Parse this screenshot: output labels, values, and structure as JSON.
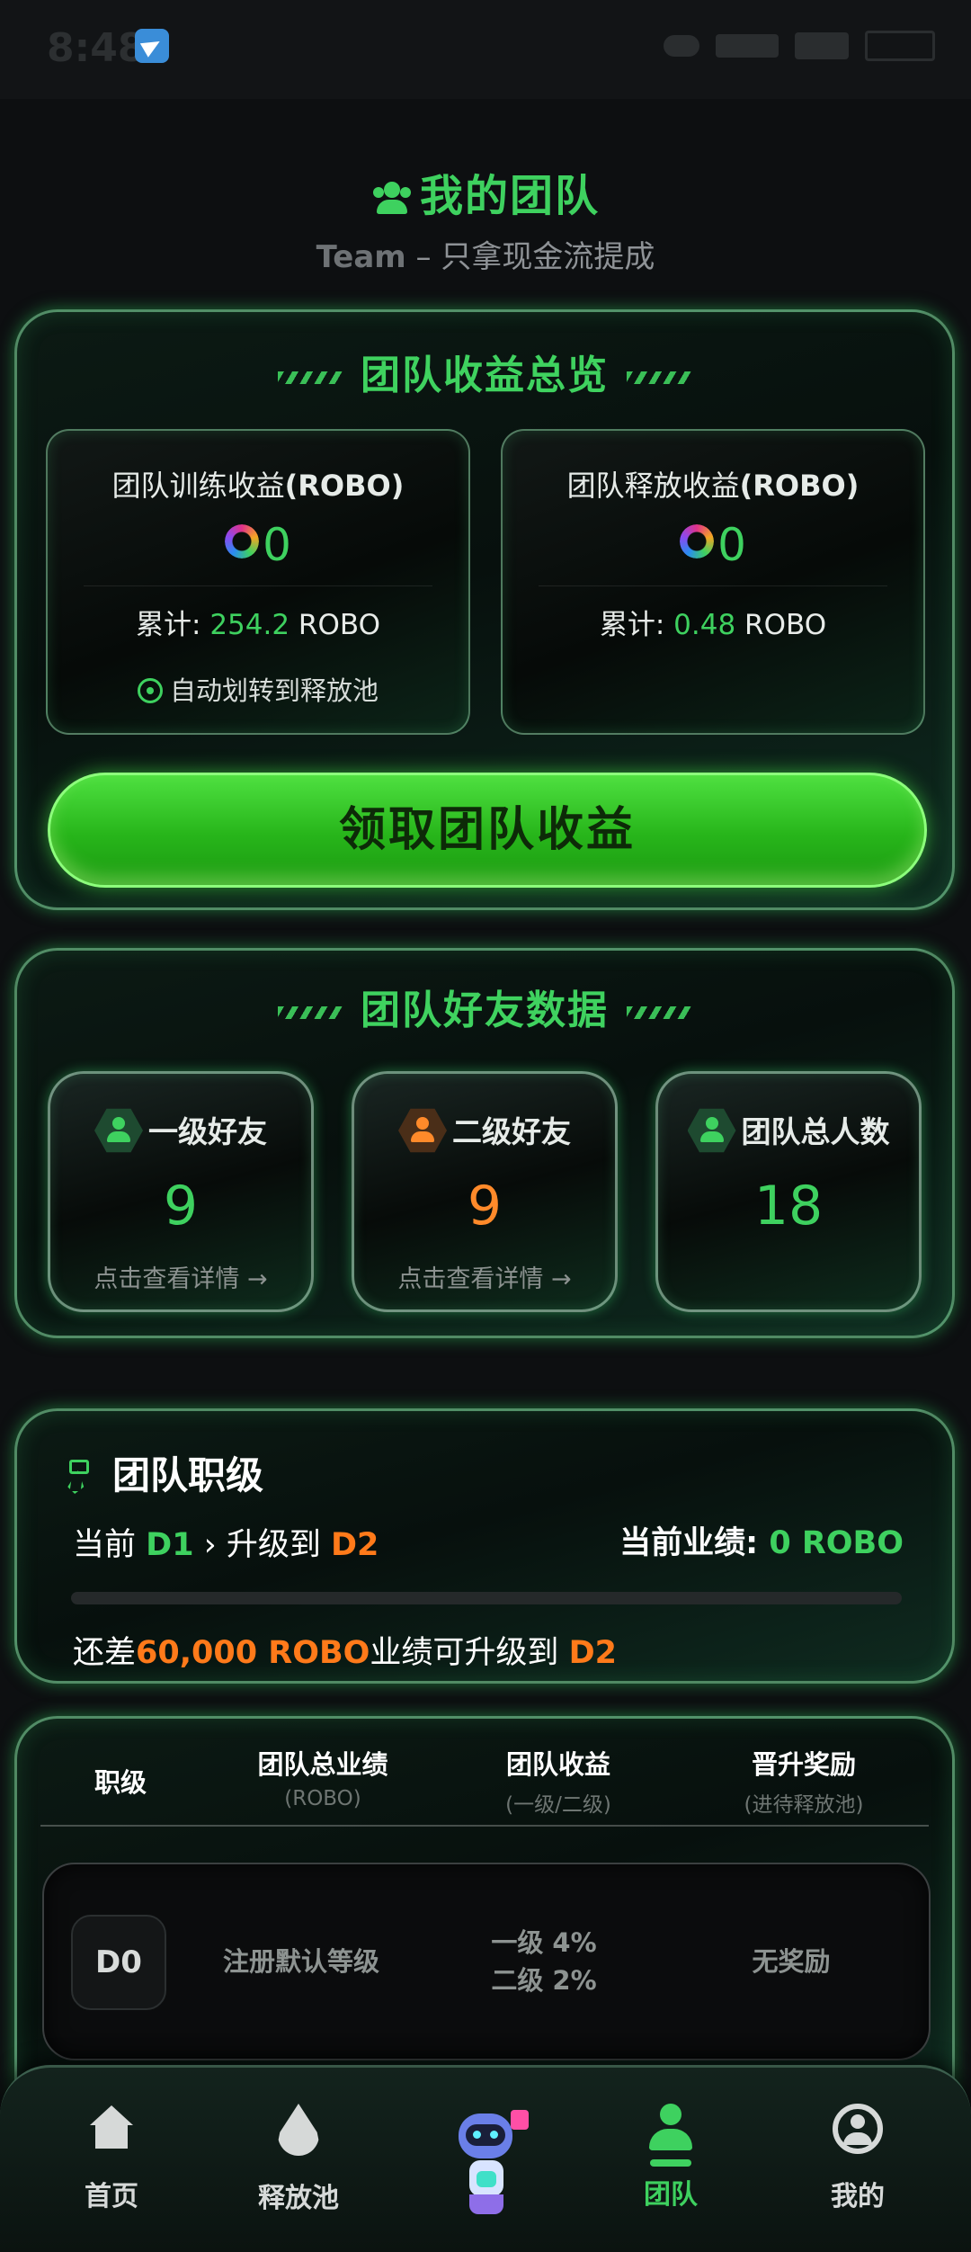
{
  "status_bar": {
    "time": "8:48"
  },
  "header": {
    "title": "我的团队",
    "subtitle_brand": "Team",
    "subtitle_text": "– 只拿现金流提成"
  },
  "overview": {
    "heading": "团队收益总览",
    "training": {
      "title": "团队训练收益",
      "unit": "(ROBO)",
      "value": "0",
      "total_label": "累计: ",
      "total_value": "254.2",
      "total_unit": " ROBO",
      "note": "自动划转到释放池"
    },
    "release": {
      "title": "团队释放收益",
      "unit": "(ROBO)",
      "value": "0",
      "total_label": "累计: ",
      "total_value": "0.48",
      "total_unit": " ROBO"
    },
    "claim_button": "领取团队收益"
  },
  "friends": {
    "heading": "团队好友数据",
    "cards": [
      {
        "title": "一级好友",
        "count": "9",
        "link": "点击查看详情 →",
        "color": "#3ed15f",
        "icon": "user-icon"
      },
      {
        "title": "二级好友",
        "count": "9",
        "link": "点击查看详情 →",
        "color": "#ff8a2a",
        "icon": "users-icon"
      },
      {
        "title": "团队总人数",
        "count": "18",
        "color": "#3ed15f",
        "icon": "group-icon"
      }
    ]
  },
  "rank": {
    "heading": "团队职级",
    "current_prefix": "当前",
    "current_level": "D1",
    "upgrade_text": "› 升级到",
    "next_level": "D2",
    "perf_label": "当前业绩:",
    "perf_value": "0 ROBO",
    "progress": 0,
    "need_prefix": "还差",
    "need_amount": "60,000 ROBO",
    "need_suffix": "业绩可升级到",
    "need_level": "D2"
  },
  "tiers": {
    "headers": [
      {
        "label": "职级",
        "sub": ""
      },
      {
        "label": "团队总业绩",
        "sub": "(ROBO)"
      },
      {
        "label": "团队收益",
        "sub": "(一级/二级)"
      },
      {
        "label": "晋升奖励",
        "sub": "(进待释放池)"
      }
    ],
    "rows": [
      {
        "level": "D0",
        "requirement": "注册默认等级",
        "share_l1": "一级 4%",
        "share_l2": "二级 2%",
        "reward": "无奖励"
      }
    ]
  },
  "nav": {
    "items": [
      {
        "label": "首页",
        "icon": "home-icon"
      },
      {
        "label": "释放池",
        "icon": "drop-icon"
      },
      {
        "label": "",
        "icon": "robot-icon"
      },
      {
        "label": "团队",
        "icon": "team-icon",
        "active": true
      },
      {
        "label": "我的",
        "icon": "profile-icon"
      }
    ]
  },
  "colors": {
    "accent": "#3ed15f",
    "warning": "#ff7a1a",
    "background": "#0d0f11"
  }
}
